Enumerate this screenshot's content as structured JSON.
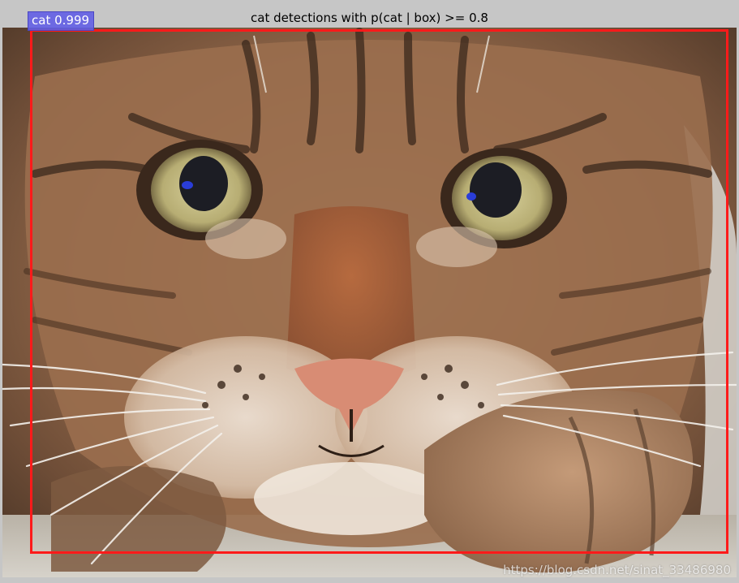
{
  "figure": {
    "title": "cat detections with p(cat | box) >= 0.8",
    "background_color": "#c6c6c6"
  },
  "detections": [
    {
      "label": "cat 0.999",
      "class": "cat",
      "score": 0.999,
      "box_color": "#ff1a1a",
      "label_bg_color": "#625ee4"
    }
  ],
  "image": {
    "subject": "tabby-cat-photo"
  },
  "watermark": {
    "text": "https://blog.csdn.net/sinat_33486980"
  }
}
